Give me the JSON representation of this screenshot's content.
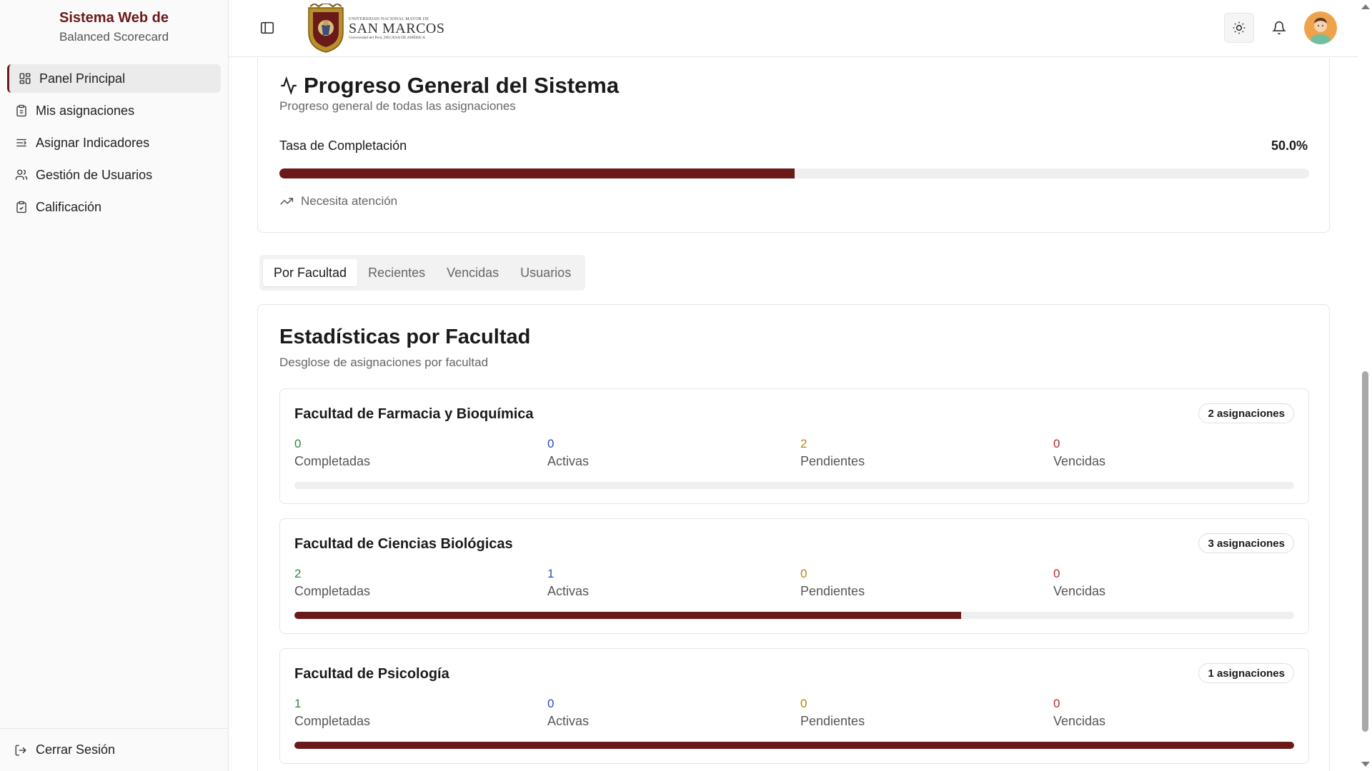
{
  "sidebar": {
    "brand_title": "Sistema Web de",
    "brand_subtitle": "Balanced Scorecard",
    "items": [
      {
        "label": "Panel Principal",
        "icon": "dashboard-icon",
        "active": true
      },
      {
        "label": "Mis asignaciones",
        "icon": "clipboard-icon"
      },
      {
        "label": "Asignar Indicadores",
        "icon": "list-indent-icon"
      },
      {
        "label": "Gestión de Usuarios",
        "icon": "users-icon"
      },
      {
        "label": "Calificación",
        "icon": "clipboard-check-icon"
      }
    ],
    "logout_label": "Cerrar Sesión"
  },
  "header": {
    "logo_top_text": "UNIVERSIDAD NACIONAL MAYOR DE",
    "logo_main_text": "SAN MARCOS",
    "logo_bottom_text": "Universidad del Perú, DECANA DE AMÉRICA",
    "icons": [
      "panel-toggle-icon",
      "sun-icon",
      "bell-icon",
      "avatar"
    ]
  },
  "progress": {
    "title": "Progreso General del Sistema",
    "subtitle": "Progreso general de todas las asignaciones",
    "rate_label": "Tasa de Completación",
    "rate_value": "50.0%",
    "rate_fraction": 0.5,
    "status": "Necesita atención"
  },
  "tabs": [
    {
      "label": "Por Facultad",
      "active": true
    },
    {
      "label": "Recientes"
    },
    {
      "label": "Vencidas"
    },
    {
      "label": "Usuarios"
    }
  ],
  "stats": {
    "title": "Estadísticas por Facultad",
    "subtitle": "Desglose de asignaciones por facultad",
    "labels": {
      "completed": "Completadas",
      "active": "Activas",
      "pending": "Pendientes",
      "overdue": "Vencidas"
    },
    "faculties": [
      {
        "name": "Facultad de Farmacia y Bioquímica",
        "badge": "2 asignaciones",
        "completed": "0",
        "active": "0",
        "pending": "2",
        "overdue": "0",
        "progress": 0
      },
      {
        "name": "Facultad de Ciencias Biológicas",
        "badge": "3 asignaciones",
        "completed": "2",
        "active": "1",
        "pending": "0",
        "overdue": "0",
        "progress": 0.667
      },
      {
        "name": "Facultad de Psicología",
        "badge": "1 asignaciones",
        "completed": "1",
        "active": "0",
        "pending": "0",
        "overdue": "0",
        "progress": 1
      }
    ]
  },
  "colors": {
    "accent": "#6b1a1a",
    "completed": "#2e8b3a",
    "active": "#2a4fc4",
    "pending": "#b8860b",
    "overdue": "#b52a2a"
  }
}
